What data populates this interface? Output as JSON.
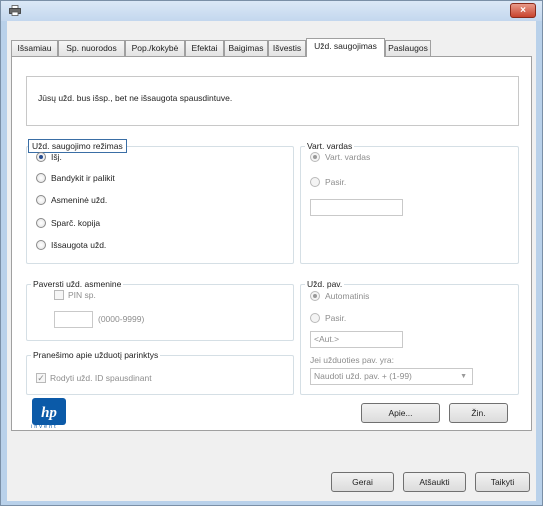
{
  "window": {
    "close_label": "×"
  },
  "tabs": [
    {
      "label": "Išsamiau",
      "active": false
    },
    {
      "label": "Sp. nuorodos",
      "active": false
    },
    {
      "label": "Pop./kokybė",
      "active": false
    },
    {
      "label": "Efektai",
      "active": false
    },
    {
      "label": "Baigimas",
      "active": false
    },
    {
      "label": "Išvestis",
      "active": false
    },
    {
      "label": "Užd. saugojimas",
      "active": true
    },
    {
      "label": "Paslaugos",
      "active": false
    }
  ],
  "info": {
    "text": "Jūsų užd. bus išsp., bet ne išsaugota spausdintuve."
  },
  "storage_mode": {
    "title": "Užd. saugojimo režimas",
    "options": [
      {
        "label": "Išj.",
        "selected": true
      },
      {
        "label": "Bandykit ir palikit",
        "selected": false
      },
      {
        "label": "Asmeninė užd.",
        "selected": false
      },
      {
        "label": "Sparč. kopija",
        "selected": false
      },
      {
        "label": "Išsaugota užd.",
        "selected": false
      }
    ]
  },
  "make_private": {
    "title": "Paversti užd. asmenine",
    "pin_label": "PIN sp.",
    "pin_value": "",
    "pin_range": "(0000-9999)"
  },
  "notification": {
    "title": "Pranešimo apie užduotį parinktys",
    "show_id_label": "Rodyti užd. ID spausdinant",
    "show_id_checked": true
  },
  "user_name": {
    "title": "Vart. vardas",
    "option_user": "Vart. vardas",
    "option_custom": "Pasir.",
    "custom_value": ""
  },
  "job_name": {
    "title": "Užd. pav.",
    "option_auto": "Automatinis",
    "option_custom": "Pasir.",
    "custom_value": "<Aut.>",
    "exists_label": "Jei užduoties pav. yra:",
    "exists_selected": "Naudoti užd. pav. + (1-99)"
  },
  "buttons": {
    "about": "Apie...",
    "help": "Žin.",
    "ok": "Gerai",
    "cancel": "Atšaukti",
    "apply": "Taikyti"
  },
  "logo": {
    "text": "invent"
  },
  "colors": {
    "focus_border": "#3a6ea5",
    "hp_blue": "#0b5aa8"
  }
}
